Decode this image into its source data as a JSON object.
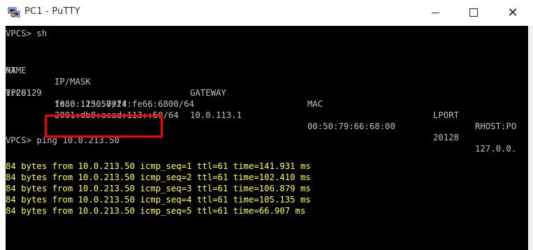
{
  "window": {
    "title": "PC1 - PuTTY",
    "close_glyph": "✕"
  },
  "terminal": {
    "prompt1": "VPCS> ",
    "cmd1": "sh",
    "headers": {
      "name": "NAME",
      "ipmask": "IP/MASK",
      "gateway": "GATEWAY",
      "mac": "MAC",
      "lport": "LPORT",
      "rhost": "RHOST:PO"
    },
    "header_wrap": "RT",
    "row": {
      "name": "VPCS1",
      "ipmask": "10.0.113.50/24",
      "gateway": "10.0.113.1",
      "mac": "00:50:79:66:68:00",
      "lport": "20128",
      "rhost": "127.0.0."
    },
    "row_wrap": "1:20129",
    "ipv6_1": "fe80::250:79ff:fe66:6800/64",
    "ipv6_2": "2001:db8:acad:113::50/64",
    "prompt2": "VPCS> ",
    "cmd2": "ping 10.0.213.50",
    "replies": [
      "84 bytes from 10.0.213.50 icmp_seq=1 ttl=61 time=141.931 ms",
      "84 bytes from 10.0.213.50 icmp_seq=2 ttl=61 time=102.410 ms",
      "84 bytes from 10.0.213.50 icmp_seq=3 ttl=61 time=106.879 ms",
      "84 bytes from 10.0.213.50 icmp_seq=4 ttl=61 time=105.135 ms",
      "84 bytes from 10.0.213.50 icmp_seq=5 ttl=61 time=66.907 ms"
    ]
  },
  "colors": {
    "terminal_bg": "#000000",
    "text": "#c0c0c0",
    "yellow": "#ffff55",
    "highlight": "#ff0000"
  }
}
